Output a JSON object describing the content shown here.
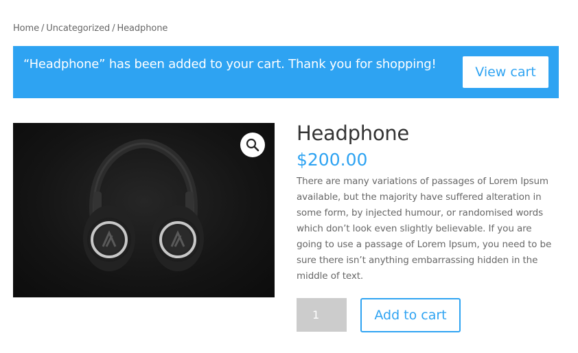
{
  "breadcrumb": {
    "items": [
      "Home",
      "Uncategorized",
      "Headphone"
    ],
    "separator": "/"
  },
  "notice": {
    "message": "“Headphone” has been added to your cart. Thank you for shopping!",
    "button_label": "View cart",
    "background_color": "#2ea3f2"
  },
  "product": {
    "image_icon": "zoom-magnifier-icon",
    "title": "Headphone",
    "price": "$200.00",
    "description": "There are many variations of passages of Lorem Ipsum available, but the majority have suffered alteration in some form, by injected humour, or randomised words which don’t look even slightly believable. If you are going to use a passage of Lorem Ipsum, you need to be sure there isn’t anything embarrassing hidden in the middle of text.",
    "quantity": "1",
    "add_to_cart_label": "Add to cart",
    "accent_color": "#2ea3f2"
  }
}
